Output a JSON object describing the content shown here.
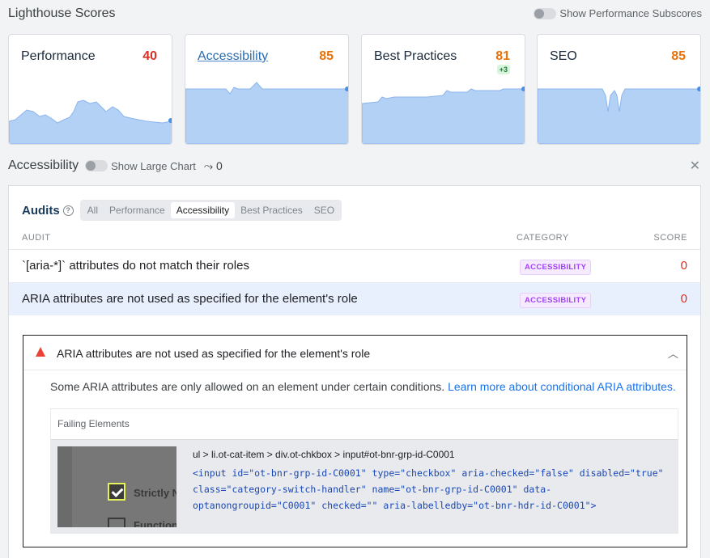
{
  "header": {
    "title": "Lighthouse Scores",
    "subscores_label": "Show Performance Subscores"
  },
  "cards": [
    {
      "name": "Performance",
      "score": "40",
      "score_color": "#d93025",
      "delta": ""
    },
    {
      "name": "Accessibility",
      "score": "85",
      "score_color": "#e8710a",
      "delta": ""
    },
    {
      "name": "Best Practices",
      "score": "81",
      "score_color": "#e8710a",
      "delta": "+3"
    },
    {
      "name": "SEO",
      "score": "85",
      "score_color": "#e8710a",
      "delta": ""
    }
  ],
  "section": {
    "title": "Accessibility",
    "large_chart_label": "Show Large Chart",
    "trend_value": "0"
  },
  "audits": {
    "title": "Audits",
    "tabs": [
      "All",
      "Performance",
      "Accessibility",
      "Best Practices",
      "SEO"
    ],
    "active_tab": "Accessibility",
    "columns": {
      "audit": "AUDIT",
      "category": "CATEGORY",
      "score": "SCORE"
    },
    "rows": [
      {
        "title": "`[aria-*]` attributes do not match their roles",
        "category": "ACCESSIBILITY",
        "score": "0"
      },
      {
        "title": "ARIA attributes are not used as specified for the element's role",
        "category": "ACCESSIBILITY",
        "score": "0"
      }
    ]
  },
  "detail": {
    "title": "ARIA attributes are not used as specified for the element's role",
    "description": "Some ARIA attributes are only allowed on an element under certain conditions.",
    "link_text": "Learn more about conditional ARIA attributes.",
    "failing_label": "Failing Elements",
    "selector": "ul > li.ot-cat-item > div.ot-chkbox > input#ot-bnr-grp-id-C0001",
    "snippet": "<input id=\"ot-bnr-grp-id-C0001\" type=\"checkbox\" aria-checked=\"false\" disabled=\"true\" class=\"category-switch-handler\" name=\"ot-bnr-grp-id-C0001\" data-optanongroupid=\"C0001\" checked=\"\" aria-labelledby=\"ot-bnr-hdr-id-C0001\">",
    "thumb_label_1": "Strictly Ne",
    "thumb_label_2": "Functiona"
  },
  "colors": {
    "accent": "#1a73e8",
    "fail": "#d93025",
    "average": "#e8710a",
    "chart_fill": "#b3d1f5",
    "chart_line": "#4a90e2"
  }
}
